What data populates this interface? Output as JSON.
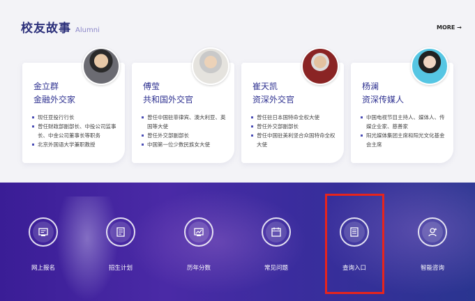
{
  "section": {
    "title_cn": "校友故事",
    "title_en": "Alumni",
    "more": "MORE →"
  },
  "cards": [
    {
      "name": "金立群",
      "role": "金融外交家",
      "bullets": [
        "现任亚投行行长",
        "曾任财政部副部长、中投公司监事长、中金公司董事长等职务",
        "北京外国语大学兼职教授"
      ]
    },
    {
      "name": "傅莹",
      "role": "共和国外交官",
      "bullets": [
        "曾任中国驻菲律宾、澳大利亚、英国等大使",
        "曾任外交部副部长",
        "中国第一位少数民族女大使"
      ]
    },
    {
      "name": "崔天凯",
      "role": "资深外交官",
      "bullets": [
        "曾任驻日本国特命全权大使",
        "曾任外交部副部长",
        "曾任中国驻美利坚合众国特命全权大使"
      ]
    },
    {
      "name": "杨澜",
      "role": "资深传媒人",
      "bullets": [
        "中国电视节目主持人、媒体人、传媒企业家、慈善家",
        "阳光媒体集团主席和阳光文化基金会主席"
      ]
    }
  ],
  "entries": [
    {
      "label": "网上报名",
      "icon": "online-register-icon"
    },
    {
      "label": "招生计划",
      "icon": "enrollment-plan-icon"
    },
    {
      "label": "历年分数",
      "icon": "past-scores-icon"
    },
    {
      "label": "常见问题",
      "icon": "faq-icon"
    },
    {
      "label": "查询入口",
      "icon": "query-entry-icon"
    },
    {
      "label": "智能咨询",
      "icon": "smart-consult-icon"
    }
  ],
  "colors": {
    "accent": "#2e3190",
    "banner": "#3a1d96",
    "highlight": "#e8241c"
  }
}
